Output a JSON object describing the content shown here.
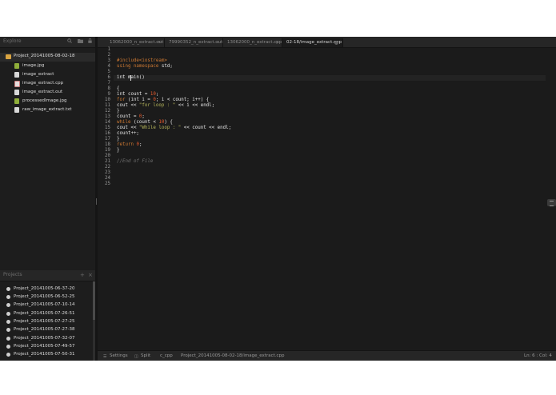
{
  "sidebar": {
    "explore_title": "Explore",
    "explore_icons": [
      "search-icon",
      "folder-icon",
      "lock-icon"
    ],
    "root_folder": "Project_20141005-08-02-18",
    "files": [
      {
        "name": "image.jpg",
        "type": "image"
      },
      {
        "name": "image_extract",
        "type": "document"
      },
      {
        "name": "image_extract.cpp",
        "type": "cpp"
      },
      {
        "name": "image_extract.out",
        "type": "document"
      },
      {
        "name": "processedImage.jpg",
        "type": "image"
      },
      {
        "name": "raw_image_extract.txt",
        "type": "document"
      }
    ],
    "projects_title": "Projects",
    "projects_icons": [
      "plus-icon",
      "close-icon"
    ],
    "projects": [
      "Project_20141005-06-37-20",
      "Project_20141005-06-52-25",
      "Project_20141005-07-10-14",
      "Project_20141005-07-26-51",
      "Project_20141005-07-27-25",
      "Project_20141005-07-27-38",
      "Project_20141005-07-32-07",
      "Project_20141005-07-49-57",
      "Project_20141005-07-50-31"
    ]
  },
  "tabs": [
    {
      "label": "13062000_n_extract.out",
      "close": "×"
    },
    {
      "label": "79990352_n_extract.out",
      "close": "×"
    },
    {
      "label": "13062000_n_extract.cpp",
      "close": "×"
    },
    {
      "label": "02-18/image_extract.cpp",
      "close": "",
      "active": true
    }
  ],
  "window_close": "×",
  "editor": {
    "line_numbers": [
      "1",
      "2",
      "3",
      "4",
      "5",
      "6",
      "7",
      "8",
      "9",
      "10",
      "11",
      "12",
      "13",
      "14",
      "15",
      "16",
      "17",
      "18",
      "19",
      "20",
      "21",
      "22",
      "23",
      "24",
      "25"
    ],
    "lines": {
      "l3": "#include<iostream>",
      "l4_kw": "using namespace",
      "l4_rest": " std;",
      "l6": "int main()",
      "l8": "{",
      "l9_a": "int count = ",
      "l9_num": "10",
      "l9_b": ";",
      "l10_kw": "for",
      "l10_a": " (int i = ",
      "l10_num": "0",
      "l10_b": "; i < count; i++) {",
      "l11_a": "cout << ",
      "l11_str": "\"for loop : \"",
      "l11_b": " << i << endl;",
      "l12": "}",
      "l13_a": "count = ",
      "l13_num": "0",
      "l13_b": ";",
      "l14_kw": "while",
      "l14_a": " (count < ",
      "l14_num": "10",
      "l14_b": ") {",
      "l15_a": "cout << ",
      "l15_str": "\"While loop : \"",
      "l15_b": " << count << endl;",
      "l16": "count++;",
      "l17": "}",
      "l18_kw": "return",
      "l18_sp": " ",
      "l18_num": "0",
      "l18_b": ";",
      "l19": "}",
      "l21": "//End of File"
    }
  },
  "statusbar": {
    "settings": "Settings",
    "split": "Split",
    "language": "c_cpp",
    "path": "Project_20141005-08-02-18/image_extract.cpp",
    "cursor_pos": "Ln: 6 : Col: 4"
  }
}
